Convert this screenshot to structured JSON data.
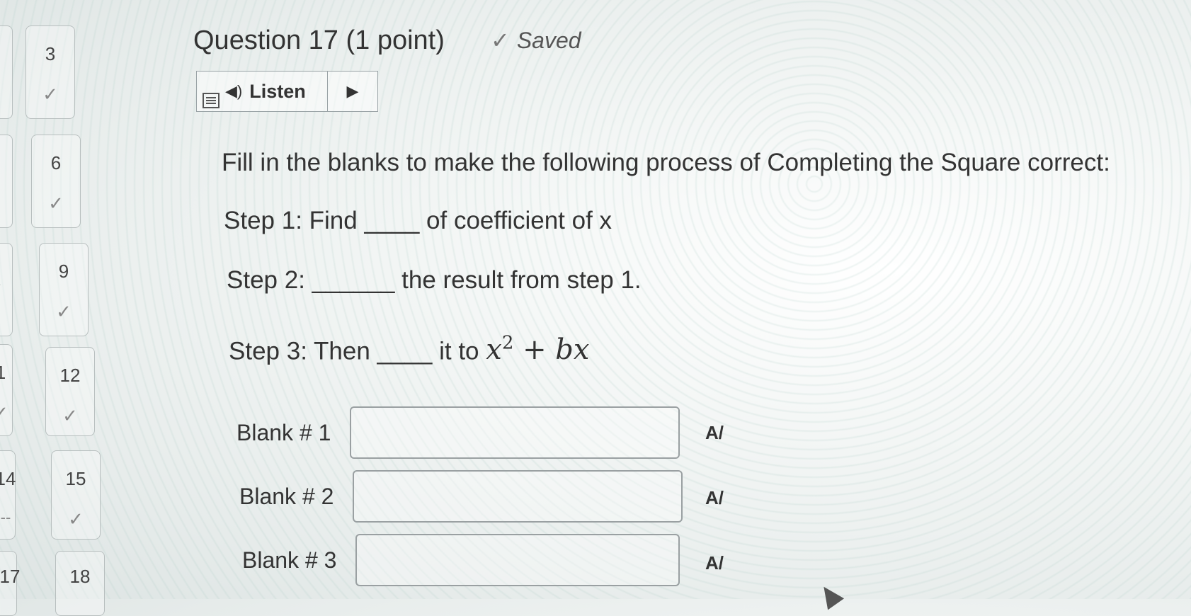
{
  "question": {
    "title": "Question 17 (1 point)",
    "saved_label": "Saved",
    "listen_label": "Listen",
    "prompt": "Fill in the blanks to make the following process of Completing the Square correct:",
    "step1": "Step 1: Find ____ of coefficient of x",
    "step2": "Step 2: ______ the result from step 1.",
    "step3_text": "Step 3: Then ____ it to",
    "step3_math_base": "x",
    "step3_math_exp": "2",
    "step3_math_rest": " + bx"
  },
  "blanks": [
    {
      "label": "Blank # 1",
      "value": ""
    },
    {
      "label": "Blank # 2",
      "value": ""
    },
    {
      "label": "Blank # 3",
      "value": ""
    }
  ],
  "spellcheck_glyph": "A/",
  "nav": {
    "left_partial": [
      {
        "num": "",
        "mark": ""
      },
      {
        "num": "",
        "mark": ""
      },
      {
        "num": "",
        "mark": "✓"
      },
      {
        "num": "1",
        "mark": "✓"
      },
      {
        "num": "14",
        "mark": "--"
      },
      {
        "num": "17",
        "mark": ""
      }
    ],
    "right": [
      {
        "num": "3",
        "mark": "✓"
      },
      {
        "num": "6",
        "mark": "✓"
      },
      {
        "num": "9",
        "mark": "✓"
      },
      {
        "num": "12",
        "mark": "✓"
      },
      {
        "num": "15",
        "mark": "✓"
      },
      {
        "num": "18",
        "mark": ""
      }
    ]
  }
}
